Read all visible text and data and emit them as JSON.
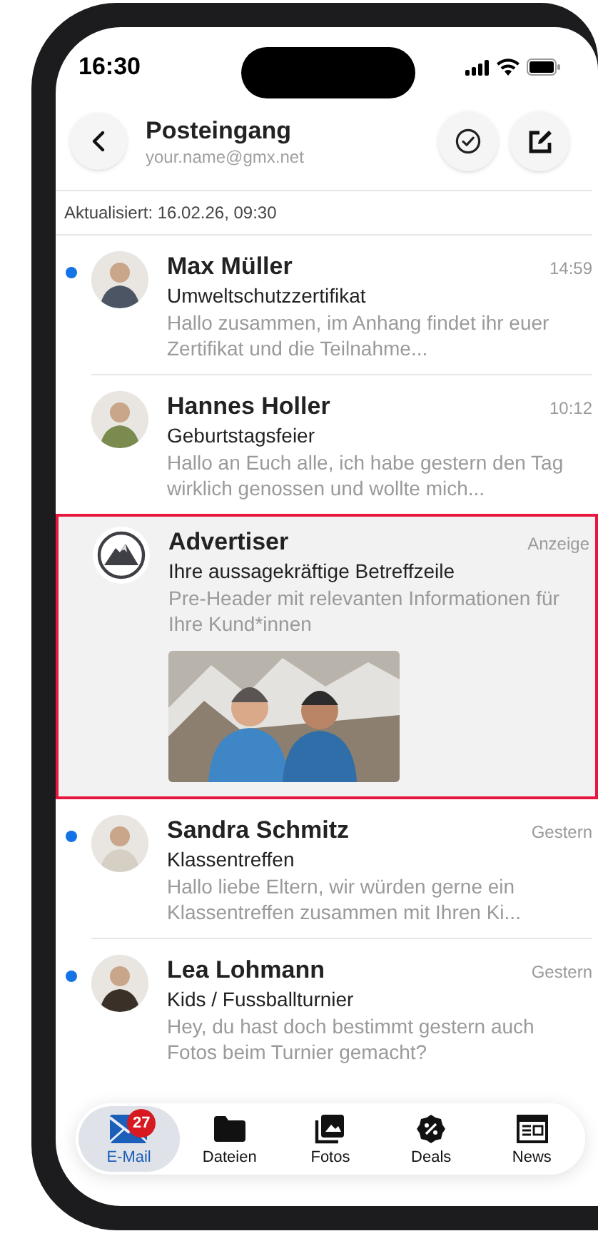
{
  "status_bar": {
    "time": "16:30"
  },
  "header": {
    "title": "Posteingang",
    "account": "your.name@gmx.net"
  },
  "updated": "Aktualisiert: 16.02.26, 09:30",
  "messages": [
    {
      "kind": "mail",
      "unread": true,
      "sender": "Max Müller",
      "time": "14:59",
      "subject": "Umweltschutzzertifikat",
      "preview": "Hallo zusammen, im Anhang findet ihr euer Zertifikat und die Teilnahme...",
      "color": "#4b5563"
    },
    {
      "kind": "mail",
      "unread": false,
      "sender": "Hannes Holler",
      "time": "10:12",
      "subject": "Geburtstagsfeier",
      "preview": "Hallo an Euch alle, ich habe gestern den Tag wirklich genossen und wollte mich...",
      "color": "#7b8a4e"
    },
    {
      "kind": "ad",
      "unread": false,
      "sender": "Advertiser",
      "time": "Anzeige",
      "subject": "Ihre aussagekräftige Betreffzeile",
      "preview": "Pre-Header mit relevanten Informationen für Ihre Kund*innen",
      "color": "#3f3f46"
    },
    {
      "kind": "mail",
      "unread": true,
      "sender": "Sandra Schmitz",
      "time": "Gestern",
      "subject": "Klassentreffen",
      "preview": "Hallo liebe Eltern, wir würden gerne ein Klassentreffen zusammen mit Ihren Ki...",
      "color": "#d6cfc4"
    },
    {
      "kind": "mail",
      "unread": true,
      "sender": "Lea Lohmann",
      "time": "Gestern",
      "subject": "Kids / Fussballturnier",
      "preview": "Hey, du hast doch bestimmt gestern auch Fotos beim Turnier gemacht?",
      "color": "#3b3028"
    }
  ],
  "tab_bar": [
    {
      "kind": "mail",
      "label": "E-Mail",
      "selected": true,
      "badge": "27"
    },
    {
      "kind": "files",
      "label": "Dateien",
      "selected": false
    },
    {
      "kind": "photos",
      "label": "Fotos",
      "selected": false
    },
    {
      "kind": "deals",
      "label": "Deals",
      "selected": false
    },
    {
      "kind": "news",
      "label": "News",
      "selected": false
    }
  ]
}
